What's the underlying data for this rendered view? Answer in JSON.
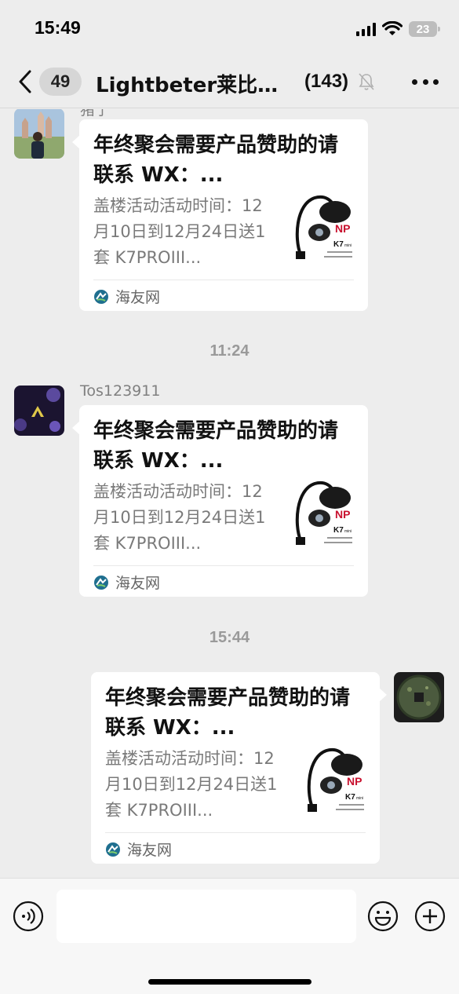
{
  "status_bar": {
    "time": "15:49",
    "battery": "23"
  },
  "nav": {
    "unread_count": "49",
    "title": "Lightbeter莱比…",
    "member_count": "(143)"
  },
  "messages": [
    {
      "sender": "猪宁",
      "title": "年终聚会需要产品赞助的请联系 WX：...",
      "description": "盖楼活动活动时间：12月10日到12月24日送1套 K7PROIII...",
      "source": "海友网",
      "thumb_brand": "K7",
      "thumb_model": "mini"
    },
    {
      "timestamp": "11:24",
      "sender": "Tos123911",
      "title": "年终聚会需要产品赞助的请联系 WX：...",
      "description": "盖楼活动活动时间：12月10日到12月24日送1套 K7PROIII...",
      "source": "海友网",
      "thumb_brand": "K7",
      "thumb_model": "mini"
    },
    {
      "timestamp": "15:44",
      "title": "年终聚会需要产品赞助的请联系 WX：...",
      "description": "盖楼活动活动时间：12月10日到12月24日送1套 K7PROIII...",
      "source": "海友网",
      "thumb_brand": "K7",
      "thumb_model": "mini"
    }
  ],
  "input": {
    "placeholder": ""
  },
  "colors": {
    "background": "#ededed",
    "bubble": "#ffffff",
    "secondary_text": "#7a7a7a",
    "brand_red": "#c8102e"
  }
}
